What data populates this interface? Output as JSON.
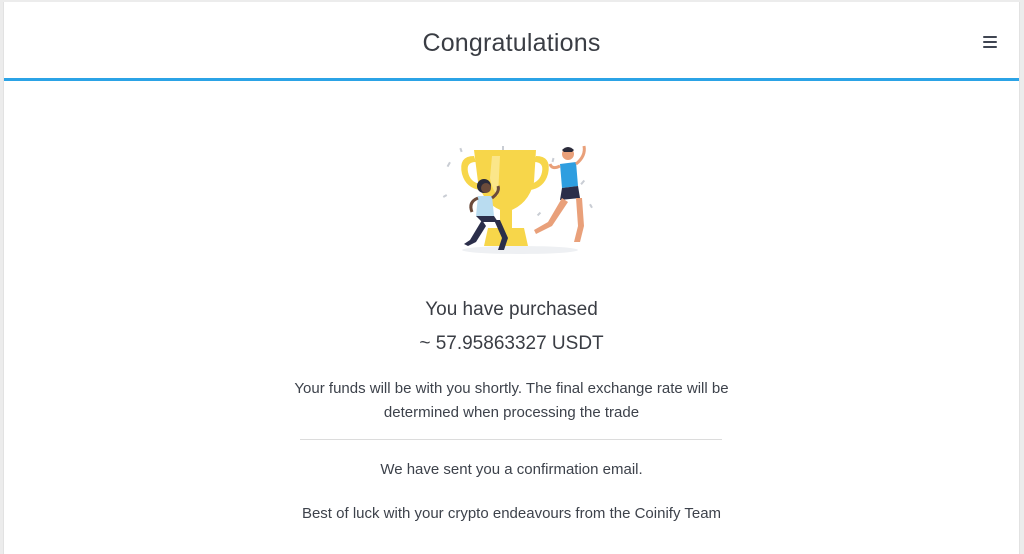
{
  "header": {
    "title": "Congratulations",
    "menu_icon": "hamburger-menu-icon",
    "accent_color": "#2ba3e6"
  },
  "illustration": {
    "icon": "trophy-celebration-illustration",
    "trophy_color": "#f7d64a",
    "figure_shirt_color": "#2e9ee0"
  },
  "purchase": {
    "label": "You have purchased",
    "amount": "~ 57.95863327 USDT"
  },
  "notes": {
    "funds": "Your funds will be with you shortly. The final exchange rate will be determined when processing the trade",
    "email": "We have sent you a confirmation email.",
    "farewell": "Best of luck with your crypto endeavours from the Coinify Team"
  }
}
